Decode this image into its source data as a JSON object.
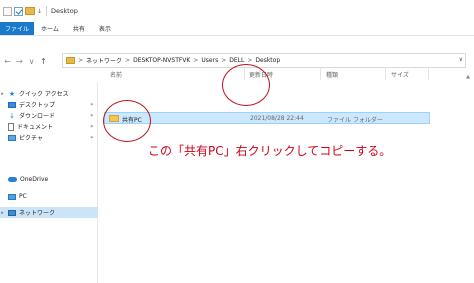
{
  "titlebar": {
    "title": "Desktop",
    "down_arrow": "↓"
  },
  "ribbon": {
    "tabs": [
      "ファイル",
      "ホーム",
      "共有",
      "表示"
    ]
  },
  "nav": {
    "back": "←",
    "forward": "→",
    "recent": "∨",
    "up": "↑",
    "breadcrumb": [
      "ネットワーク",
      "DESKTOP-NVSTFVK",
      "Users",
      "DELL",
      "Desktop"
    ],
    "separator": ">"
  },
  "sidebar": {
    "items": [
      {
        "label": "クイック アクセス",
        "icon": "star-icon"
      },
      {
        "label": "デスクトップ",
        "icon": "desktop-icon",
        "pinned": true
      },
      {
        "label": "ダウンロード",
        "icon": "download-icon",
        "pinned": true
      },
      {
        "label": "ドキュメント",
        "icon": "document-icon",
        "pinned": true
      },
      {
        "label": "ピクチャ",
        "icon": "picture-icon",
        "pinned": true
      },
      {
        "label": "OneDrive",
        "icon": "cloud-icon"
      },
      {
        "label": "PC",
        "icon": "pc-icon"
      },
      {
        "label": "ネットワーク",
        "icon": "network-icon",
        "selected": true
      }
    ]
  },
  "columns": {
    "name": "名前",
    "date": "更新日時",
    "type": "種類",
    "size": "サイズ"
  },
  "files": [
    {
      "name": "共有PC",
      "date": "2021/08/28 22:44",
      "type": "ファイル フォルダー"
    }
  ],
  "annotation": "この「共有PC」右クリックしてコピーする。",
  "colors": {
    "accent": "#1979ca",
    "selection": "#cce8ff",
    "annotation_red": "#d0021b"
  }
}
